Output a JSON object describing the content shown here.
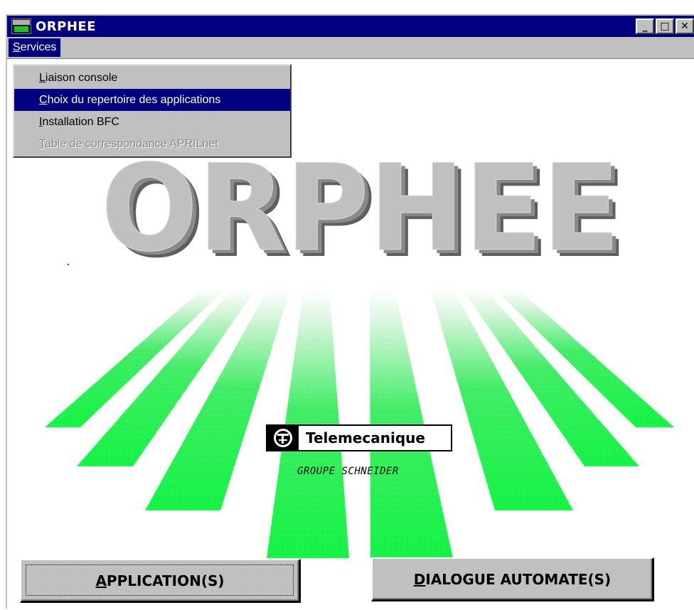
{
  "window": {
    "title": "ORPHEE",
    "controls": {
      "minimize": "_",
      "maximize": "□",
      "close": "✕"
    }
  },
  "menubar": {
    "items": [
      {
        "mnemonic": "S",
        "rest": "ervices"
      }
    ]
  },
  "dropdown": {
    "items": [
      {
        "mnemonic": "L",
        "rest": "iaison console",
        "state": "normal"
      },
      {
        "mnemonic": "C",
        "rest": "hoix du repertoire des applications",
        "state": "highlighted"
      },
      {
        "mnemonic": "I",
        "rest": "nstallation BFC",
        "state": "normal"
      },
      {
        "mnemonic": "T",
        "rest": "able de correspondance APRILnet",
        "state": "disabled"
      }
    ]
  },
  "logo": {
    "text": "ORPHEE",
    "brand_name": "Telemecanique",
    "brand_sub": "GROUPE SCHNEIDER",
    "colors": {
      "letters": "#c0c0c0",
      "letter_shadow": "#6e6e6e",
      "rays": "#00ff33"
    }
  },
  "buttons": {
    "application": {
      "mnemonic": "A",
      "rest": "PPLICATION(S)"
    },
    "dialogue": {
      "mnemonic": "D",
      "rest": "IALOGUE AUTOMATE(S)"
    }
  }
}
